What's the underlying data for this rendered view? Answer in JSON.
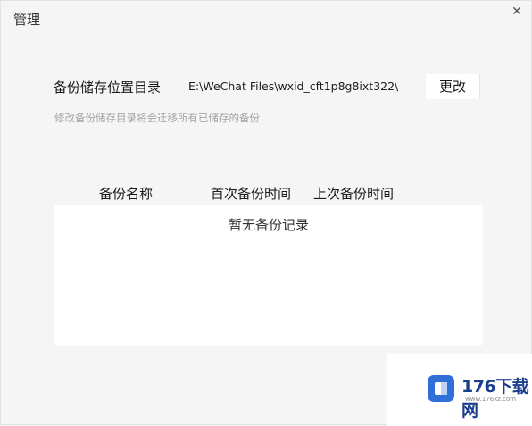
{
  "window": {
    "title": "管理",
    "close_glyph": "✕"
  },
  "backup_location": {
    "label": "备份储存位置目录",
    "path": "E:\\WeChat Files\\wxid_cft1p8g8ixt322\\",
    "change_button": "更改",
    "hint": "修改备份储存目录将会迁移所有已储存的备份"
  },
  "backup_table": {
    "columns": [
      "备份名称",
      "首次备份时间",
      "上次备份时间"
    ],
    "empty_text": "暂无备份记录",
    "rows": []
  },
  "watermark": {
    "brand": "176下载网",
    "domain": "www.176xz.com"
  },
  "colors": {
    "background": "#f5f5f5",
    "panel": "#ffffff",
    "hint_text": "#a3a3a3",
    "watermark_blue": "#2f6fd8"
  }
}
